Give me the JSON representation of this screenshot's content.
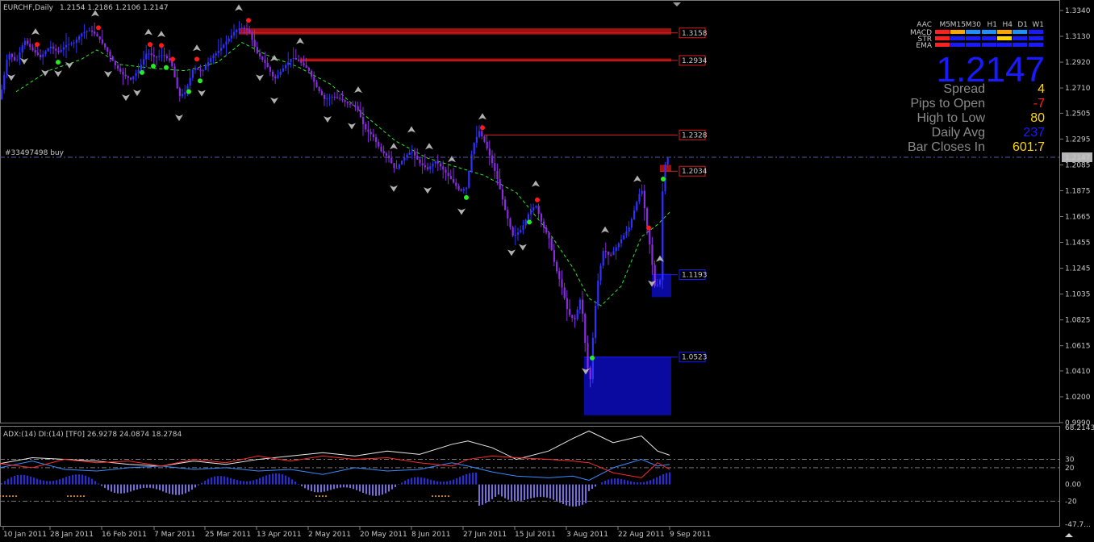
{
  "header": {
    "symbol": "EURCHF,Daily",
    "ohlc": "1.2154 1.2186 1.2106 1.2147"
  },
  "order_label": "#33497498 buy",
  "big_price": "1.2147",
  "info_panel": {
    "rows": [
      {
        "label": "Spread",
        "value": "4",
        "color": "#ffd700"
      },
      {
        "label": "Pips to Open",
        "value": "-7",
        "color": "#ff2020"
      },
      {
        "label": "High to Low",
        "value": "80",
        "color": "#ffd700"
      },
      {
        "label": "Daily Avg",
        "value": "237",
        "color": "#1a1aff"
      },
      {
        "label": "Bar Closes In",
        "value": "601:7",
        "color": "#ffd700"
      }
    ]
  },
  "signal_table": {
    "corner": "AAC",
    "timeframes": [
      "M5",
      "M15",
      "M30",
      "H1",
      "H4",
      "D1",
      "W1"
    ],
    "rows": [
      {
        "name": "MACD",
        "colors": [
          "#ff2020",
          "#ffa500",
          "#1e90ff",
          "#1e90ff",
          "#ffa500",
          "#1e90ff",
          "#1a1aff"
        ]
      },
      {
        "name": "STR",
        "colors": [
          "#ff2020",
          "#1a1aff",
          "#1a1aff",
          "#1a1aff",
          "#ffd700",
          "#1a1aff",
          "#1a1aff"
        ]
      },
      {
        "name": "EMA",
        "colors": [
          "#ff2020",
          "#1a1aff",
          "#1a1aff",
          "#1a1aff",
          "#1a1aff",
          "#1a1aff",
          "#1a1aff"
        ]
      }
    ]
  },
  "indicator_header": "ADX:(14) DI:(14) [TF0] 26.9278 24.0874 18.2784",
  "chart_data": {
    "type": "candlestick",
    "symbol": "EURCHF",
    "timeframe": "Daily",
    "y_axis": {
      "ticks": [
        "1.3340",
        "1.3130",
        "1.2920",
        "1.2710",
        "1.2505",
        "1.2295",
        "1.2085",
        "1.1875",
        "1.1665",
        "1.1455",
        "1.1245",
        "1.1035",
        "1.0825",
        "1.0615",
        "1.0410",
        "1.0200",
        "0.9990"
      ],
      "ylim": [
        0.999,
        1.334
      ]
    },
    "x_axis": {
      "ticks": [
        "10 Jan 2011",
        "28 Jan 2011",
        "16 Feb 2011",
        "7 Mar 2011",
        "25 Mar 2011",
        "13 Apr 2011",
        "2 May 2011",
        "20 May 2011",
        "8 Jun 2011",
        "27 Jun 2011",
        "15 Jul 2011",
        "3 Aug 2011",
        "22 Aug 2011",
        "9 Sep 2011"
      ]
    },
    "current_price": "1.2147",
    "close_path": [
      [
        0,
        1.262
      ],
      [
        10,
        1.3
      ],
      [
        20,
        1.292
      ],
      [
        30,
        1.31
      ],
      [
        40,
        1.302
      ],
      [
        50,
        1.296
      ],
      [
        62,
        1.305
      ],
      [
        72,
        1.3
      ],
      [
        82,
        1.306
      ],
      [
        92,
        1.308
      ],
      [
        102,
        1.316
      ],
      [
        112,
        1.318
      ],
      [
        122,
        1.312
      ],
      [
        132,
        1.302
      ],
      [
        142,
        1.29
      ],
      [
        152,
        1.282
      ],
      [
        162,
        1.278
      ],
      [
        172,
        1.286
      ],
      [
        182,
        1.3
      ],
      [
        192,
        1.296
      ],
      [
        202,
        1.298
      ],
      [
        212,
        1.292
      ],
      [
        222,
        1.264
      ],
      [
        230,
        1.268
      ],
      [
        240,
        1.288
      ],
      [
        250,
        1.284
      ],
      [
        262,
        1.296
      ],
      [
        272,
        1.302
      ],
      [
        282,
        1.31
      ],
      [
        292,
        1.318
      ],
      [
        300,
        1.32
      ],
      [
        308,
        1.318
      ],
      [
        318,
        1.3
      ],
      [
        330,
        1.29
      ],
      [
        340,
        1.278
      ],
      [
        352,
        1.288
      ],
      [
        362,
        1.296
      ],
      [
        372,
        1.292
      ],
      [
        382,
        1.286
      ],
      [
        392,
        1.272
      ],
      [
        402,
        1.262
      ],
      [
        412,
        1.264
      ],
      [
        422,
        1.262
      ],
      [
        432,
        1.258
      ],
      [
        442,
        1.256
      ],
      [
        452,
        1.238
      ],
      [
        462,
        1.232
      ],
      [
        472,
        1.22
      ],
      [
        482,
        1.214
      ],
      [
        490,
        1.204
      ],
      [
        500,
        1.214
      ],
      [
        510,
        1.22
      ],
      [
        520,
        1.21
      ],
      [
        530,
        1.205
      ],
      [
        540,
        1.212
      ],
      [
        550,
        1.204
      ],
      [
        560,
        1.196
      ],
      [
        570,
        1.187
      ],
      [
        578,
        1.19
      ],
      [
        586,
        1.224
      ],
      [
        594,
        1.236
      ],
      [
        600,
        1.228
      ],
      [
        608,
        1.214
      ],
      [
        616,
        1.198
      ],
      [
        626,
        1.172
      ],
      [
        636,
        1.15
      ],
      [
        646,
        1.156
      ],
      [
        656,
        1.17
      ],
      [
        664,
        1.176
      ],
      [
        672,
        1.16
      ],
      [
        680,
        1.15
      ],
      [
        688,
        1.126
      ],
      [
        696,
        1.11
      ],
      [
        704,
        1.088
      ],
      [
        712,
        1.082
      ],
      [
        720,
        1.102
      ],
      [
        726,
        1.058
      ],
      [
        731,
        1.028
      ],
      [
        735,
        1.07
      ],
      [
        740,
        1.11
      ],
      [
        748,
        1.14
      ],
      [
        756,
        1.134
      ],
      [
        764,
        1.142
      ],
      [
        772,
        1.15
      ],
      [
        780,
        1.158
      ],
      [
        788,
        1.176
      ],
      [
        795,
        1.19
      ],
      [
        800,
        1.168
      ],
      [
        806,
        1.14
      ],
      [
        812,
        1.108
      ],
      [
        818,
        1.115
      ],
      [
        822,
        1.205
      ],
      [
        828,
        1.2147
      ]
    ],
    "ma_path": [
      [
        20,
        1.268
      ],
      [
        60,
        1.285
      ],
      [
        100,
        1.294
      ],
      [
        120,
        1.302
      ],
      [
        150,
        1.29
      ],
      [
        190,
        1.287
      ],
      [
        230,
        1.285
      ],
      [
        270,
        1.292
      ],
      [
        300,
        1.308
      ],
      [
        330,
        1.298
      ],
      [
        370,
        1.288
      ],
      [
        410,
        1.274
      ],
      [
        450,
        1.25
      ],
      [
        490,
        1.228
      ],
      [
        530,
        1.214
      ],
      [
        570,
        1.206
      ],
      [
        600,
        1.2
      ],
      [
        640,
        1.186
      ],
      [
        680,
        1.154
      ],
      [
        710,
        1.125
      ],
      [
        730,
        1.1
      ],
      [
        745,
        1.094
      ],
      [
        770,
        1.11
      ],
      [
        795,
        1.15
      ],
      [
        815,
        1.16
      ],
      [
        830,
        1.17
      ]
    ],
    "levels": [
      {
        "label": "1.3158",
        "value": 1.3158,
        "color": "#d42020",
        "zone": [
          1.3145,
          1.3195
        ]
      },
      {
        "label": "1.2934",
        "value": 1.2934,
        "color": "#d42020",
        "zone": [
          1.2925,
          1.295
        ]
      },
      {
        "label": "1.2328",
        "value": 1.2328,
        "color": "#d42020",
        "zone": null
      },
      {
        "label": "1.2034",
        "value": 1.2034,
        "color": "#d42020",
        "zone": [
          1.203,
          1.2085
        ]
      },
      {
        "label": "1.1193",
        "value": 1.1193,
        "color": "#1a1aff",
        "zone": [
          1.101,
          1.12
        ]
      },
      {
        "label": "1.0523",
        "value": 1.0523,
        "color": "#1a1aff",
        "zone": [
          1.005,
          1.0523
        ]
      }
    ],
    "indicator": {
      "name": "ADX",
      "ticks": [
        "68.2143",
        "30",
        "20",
        "0.00",
        "-20",
        "-47.7..."
      ],
      "ylim": [
        -47.7,
        68.2143
      ],
      "adx": [
        [
          0,
          25
        ],
        [
          40,
          32
        ],
        [
          80,
          30
        ],
        [
          120,
          28
        ],
        [
          160,
          24
        ],
        [
          200,
          22
        ],
        [
          240,
          28
        ],
        [
          280,
          24
        ],
        [
          320,
          30
        ],
        [
          360,
          34
        ],
        [
          400,
          38
        ],
        [
          440,
          34
        ],
        [
          480,
          40
        ],
        [
          520,
          36
        ],
        [
          560,
          48
        ],
        [
          580,
          52
        ],
        [
          610,
          44
        ],
        [
          640,
          30
        ],
        [
          680,
          40
        ],
        [
          710,
          55
        ],
        [
          730,
          64
        ],
        [
          760,
          50
        ],
        [
          795,
          58
        ],
        [
          815,
          40
        ],
        [
          830,
          35
        ]
      ],
      "plus_di": [
        [
          0,
          20
        ],
        [
          40,
          28
        ],
        [
          80,
          18
        ],
        [
          120,
          16
        ],
        [
          160,
          20
        ],
        [
          200,
          22
        ],
        [
          240,
          18
        ],
        [
          280,
          20
        ],
        [
          320,
          16
        ],
        [
          360,
          18
        ],
        [
          400,
          12
        ],
        [
          440,
          20
        ],
        [
          480,
          16
        ],
        [
          520,
          18
        ],
        [
          560,
          26
        ],
        [
          580,
          22
        ],
        [
          610,
          15
        ],
        [
          640,
          10
        ],
        [
          680,
          8
        ],
        [
          710,
          10
        ],
        [
          730,
          5
        ],
        [
          760,
          20
        ],
        [
          795,
          30
        ],
        [
          815,
          22
        ],
        [
          830,
          24
        ]
      ],
      "minus_di": [
        [
          0,
          25
        ],
        [
          40,
          20
        ],
        [
          80,
          30
        ],
        [
          120,
          26
        ],
        [
          160,
          28
        ],
        [
          200,
          22
        ],
        [
          240,
          30
        ],
        [
          280,
          26
        ],
        [
          320,
          34
        ],
        [
          360,
          28
        ],
        [
          400,
          34
        ],
        [
          440,
          30
        ],
        [
          480,
          32
        ],
        [
          520,
          26
        ],
        [
          560,
          22
        ],
        [
          580,
          30
        ],
        [
          610,
          34
        ],
        [
          640,
          32
        ],
        [
          680,
          30
        ],
        [
          710,
          28
        ],
        [
          730,
          26
        ],
        [
          760,
          14
        ],
        [
          795,
          8
        ],
        [
          815,
          26
        ],
        [
          830,
          18
        ]
      ]
    }
  }
}
